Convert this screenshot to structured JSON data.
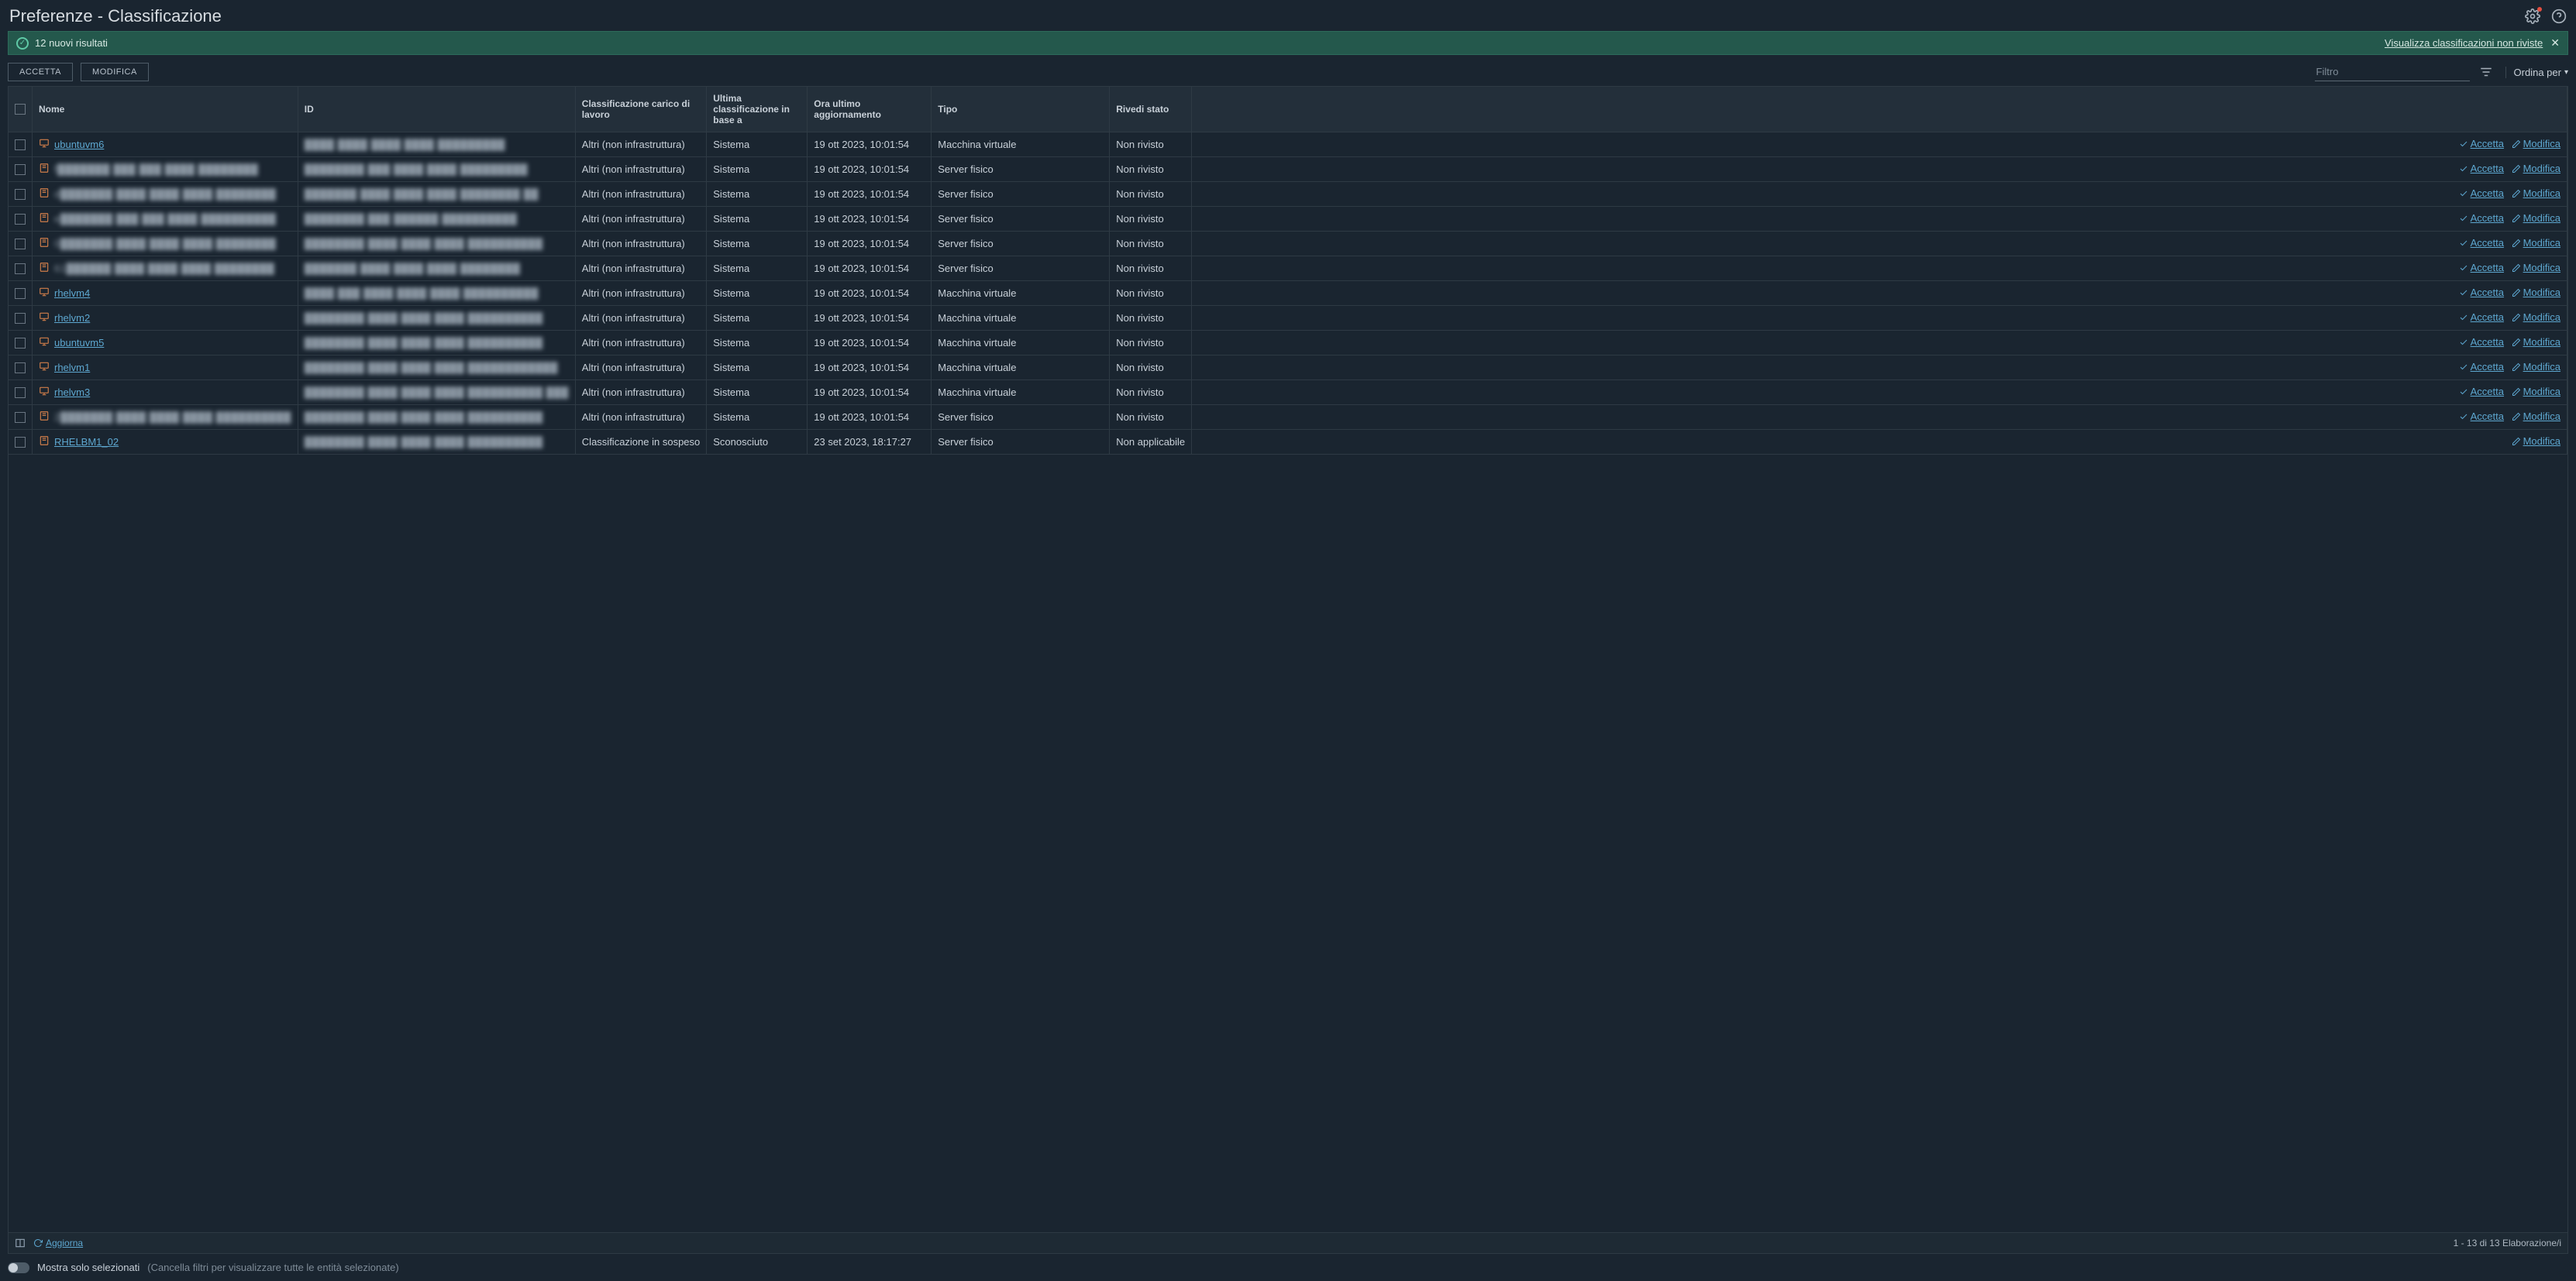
{
  "header": {
    "title": "Preferenze - Classificazione"
  },
  "banner": {
    "text": "12 nuovi risultati",
    "link": "Visualizza classificazioni non riviste"
  },
  "toolbar": {
    "accept": "ACCETTA",
    "edit": "MODIFICA",
    "filter_placeholder": "Filtro",
    "sort_by": "Ordina per"
  },
  "columns": {
    "name": "Nome",
    "id": "ID",
    "classification": "Classificazione carico di lavoro",
    "based_on": "Ultima classificazione in base a",
    "updated": "Ora ultimo aggiornamento",
    "type": "Tipo",
    "review": "Rivedi stato"
  },
  "action_labels": {
    "accept": "Accetta",
    "edit": "Modifica"
  },
  "rows": [
    {
      "icon": "vm",
      "name": "ubuntuvm6",
      "name_blur": false,
      "id": "████ ████ ████ ████ █████████",
      "classification": "Altri (non infrastruttura)",
      "based_on": "Sistema",
      "updated": "19 ott 2023, 10:01:54",
      "type": "Macchina virtuale",
      "review": "Non rivisto",
      "accept": true
    },
    {
      "icon": "phys",
      "name": "f███████ ███ ███ ████ ████████",
      "name_blur": true,
      "id": "████████ ███ ████ ████ █████████",
      "classification": "Altri (non infrastruttura)",
      "based_on": "Sistema",
      "updated": "19 ott 2023, 10:01:54",
      "type": "Server fisico",
      "review": "Non rivisto",
      "accept": true
    },
    {
      "icon": "phys",
      "name": "d███████ ████ ████ ████ ████████",
      "name_blur": true,
      "id": "███████ ████ ████ ████ ████████ ██",
      "classification": "Altri (non infrastruttura)",
      "based_on": "Sistema",
      "updated": "19 ott 2023, 10:01:54",
      "type": "Server fisico",
      "review": "Non rivisto",
      "accept": true
    },
    {
      "icon": "phys",
      "name": "e███████ ███ ███ ████ ██████████",
      "name_blur": true,
      "id": "████████ ███ ██████ ██████████",
      "classification": "Altri (non infrastruttura)",
      "based_on": "Sistema",
      "updated": "19 ott 2023, 10:01:54",
      "type": "Server fisico",
      "review": "Non rivisto",
      "accept": true
    },
    {
      "icon": "phys",
      "name": "0███████ ████ ████ ████ ████████",
      "name_blur": true,
      "id": "████████ ████ ████ ████ ██████████",
      "classification": "Altri (non infrastruttura)",
      "based_on": "Sistema",
      "updated": "19 ott 2023, 10:01:54",
      "type": "Server fisico",
      "review": "Non rivisto",
      "accept": true
    },
    {
      "icon": "phys",
      "name": "61██████ ████ ████ ████ ████████",
      "name_blur": true,
      "id": "███████ ████ ████ ████ ████████",
      "classification": "Altri (non infrastruttura)",
      "based_on": "Sistema",
      "updated": "19 ott 2023, 10:01:54",
      "type": "Server fisico",
      "review": "Non rivisto",
      "accept": true
    },
    {
      "icon": "vm",
      "name": "rhelvm4",
      "name_blur": false,
      "id": "████ ███ ████ ████ ████ ██████████",
      "classification": "Altri (non infrastruttura)",
      "based_on": "Sistema",
      "updated": "19 ott 2023, 10:01:54",
      "type": "Macchina virtuale",
      "review": "Non rivisto",
      "accept": true
    },
    {
      "icon": "vm",
      "name": "rhelvm2",
      "name_blur": false,
      "id": "████████ ████ ████ ████ ██████████",
      "classification": "Altri (non infrastruttura)",
      "based_on": "Sistema",
      "updated": "19 ott 2023, 10:01:54",
      "type": "Macchina virtuale",
      "review": "Non rivisto",
      "accept": true
    },
    {
      "icon": "vm",
      "name": "ubuntuvm5",
      "name_blur": false,
      "id": "████████ ████ ████ ████ ██████████",
      "classification": "Altri (non infrastruttura)",
      "based_on": "Sistema",
      "updated": "19 ott 2023, 10:01:54",
      "type": "Macchina virtuale",
      "review": "Non rivisto",
      "accept": true
    },
    {
      "icon": "vm",
      "name": "rhelvm1",
      "name_blur": false,
      "id": "████████ ████ ████ ████ ████████████",
      "classification": "Altri (non infrastruttura)",
      "based_on": "Sistema",
      "updated": "19 ott 2023, 10:01:54",
      "type": "Macchina virtuale",
      "review": "Non rivisto",
      "accept": true
    },
    {
      "icon": "vm",
      "name": "rhelvm3",
      "name_blur": false,
      "id": "████████ ████ ████ ████ ██████████ ███",
      "classification": "Altri (non infrastruttura)",
      "based_on": "Sistema",
      "updated": "19 ott 2023, 10:01:54",
      "type": "Macchina virtuale",
      "review": "Non rivisto",
      "accept": true
    },
    {
      "icon": "phys",
      "name": "2███████ ████ ████ ████ ██████████",
      "name_blur": true,
      "id": "████████ ████ ████ ████ ██████████",
      "classification": "Altri (non infrastruttura)",
      "based_on": "Sistema",
      "updated": "19 ott 2023, 10:01:54",
      "type": "Server fisico",
      "review": "Non rivisto",
      "accept": true
    },
    {
      "icon": "phys",
      "name": "RHELBM1_02",
      "name_blur": false,
      "id": "████████ ████ ████ ████ ██████████",
      "classification": "Classificazione in sospeso",
      "based_on": "Sconosciuto",
      "updated": "23 set 2023, 18:17:27",
      "type": "Server fisico",
      "review": "Non applicabile",
      "accept": false
    }
  ],
  "footer": {
    "refresh": "Aggiorna",
    "pagination": "1 - 13 di 13 Elaborazione/i"
  },
  "bottom": {
    "show_selected": "Mostra solo selezionati",
    "clear_filters": "(Cancella filtri per visualizzare tutte le entità selezionate)"
  }
}
